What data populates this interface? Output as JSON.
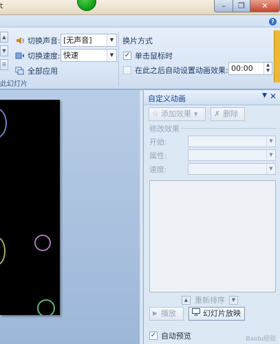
{
  "titlebar": {
    "title_fragment": "t"
  },
  "ribbon": {
    "transition_sound_label": "切换声音:",
    "transition_sound_value": "[无声音]",
    "transition_speed_label": "切换速度:",
    "transition_speed_value": "快速",
    "apply_all_label": "全部应用",
    "advance_group_title": "换片方式",
    "on_click_label": "单击鼠标时",
    "on_click_checked": true,
    "auto_after_label": "在此之后自动设置动画效果:",
    "auto_after_checked": false,
    "auto_after_value": "00:00",
    "group_label_fragment": "此幻灯片"
  },
  "pane": {
    "title": "自定义动画",
    "add_effect_label": "添加效果",
    "delete_label": "删除",
    "modify_effect_label": "修改效果",
    "start_label": "开始:",
    "property_label": "属性:",
    "speed_label": "速度:",
    "reorder_label": "重新排序",
    "play_label": "播放",
    "slideshow_label": "幻灯片放映",
    "auto_preview_label": "自动预览",
    "auto_preview_checked": true
  },
  "watermark": "Baidu经验",
  "colors": {
    "ribbon_bg": "#dbe7f6",
    "pane_bg": "#dde8f5",
    "slide_bg": "#000000",
    "close_button": "#c4442c",
    "accent_text": "#15428b"
  }
}
